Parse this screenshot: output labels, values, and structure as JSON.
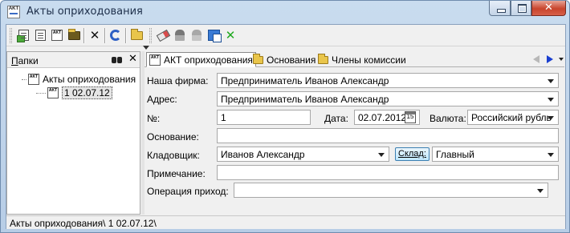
{
  "window": {
    "title": "Акты оприходования",
    "controls": {
      "minimize": "minimize",
      "maximize": "maximize",
      "close": "x"
    }
  },
  "app_icon": {
    "text": "AKT"
  },
  "toolbar": {
    "buttons": [
      "add-document-icon",
      "copy-document-icon",
      "akt-document-icon",
      "folder-edit-icon",
      "delete-x-icon",
      "refresh-icon",
      "folder-open-icon",
      "eraser-icon",
      "stamp-icon",
      "stamp-gray-icon",
      "copy-blue-icon",
      "green-x-icon"
    ]
  },
  "left_pane": {
    "title_prefix": "П",
    "title_rest": "апки",
    "tree": [
      {
        "label": "Акты оприходования",
        "level": 0
      },
      {
        "label": "1 02.07.12",
        "level": 1,
        "selected": true
      }
    ]
  },
  "tabs": [
    {
      "label": "АКТ оприходования",
      "icon": "akt-icon",
      "active": true
    },
    {
      "label": "Основания",
      "icon": "folder-icon",
      "active": false
    },
    {
      "label": "Члены комиссии",
      "icon": "folder-icon",
      "active": false
    }
  ],
  "form": {
    "firm_label": "Наша фирма:",
    "firm_value": "Предприниматель Иванов Александр",
    "address_label": "Адрес:",
    "address_value": "Предприниматель Иванов Александр",
    "number_label": "№:",
    "number_value": "1",
    "date_label": "Дата:",
    "date_value": "02.07.2012",
    "date_icon_text": "15",
    "currency_label": "Валюта:",
    "currency_value": "Российский рубль",
    "basis_label": "Основание:",
    "basis_value": "",
    "storekeeper_label": "Кладовщик:",
    "storekeeper_value": "Иванов Александр",
    "warehouse_button": "Склад:",
    "warehouse_value": "Главный",
    "note_label": "Примечание:",
    "note_value": "",
    "operation_label": "Операция приход:",
    "operation_value": ""
  },
  "status_bar": {
    "text": "Акты оприходования\\ 1 02.07.12\\"
  },
  "colors": {
    "window_frame": "#b7cde6",
    "close_button": "#c8442c",
    "nav_arrow_active": "#1a3fd0",
    "folder": "#e9c54a"
  }
}
